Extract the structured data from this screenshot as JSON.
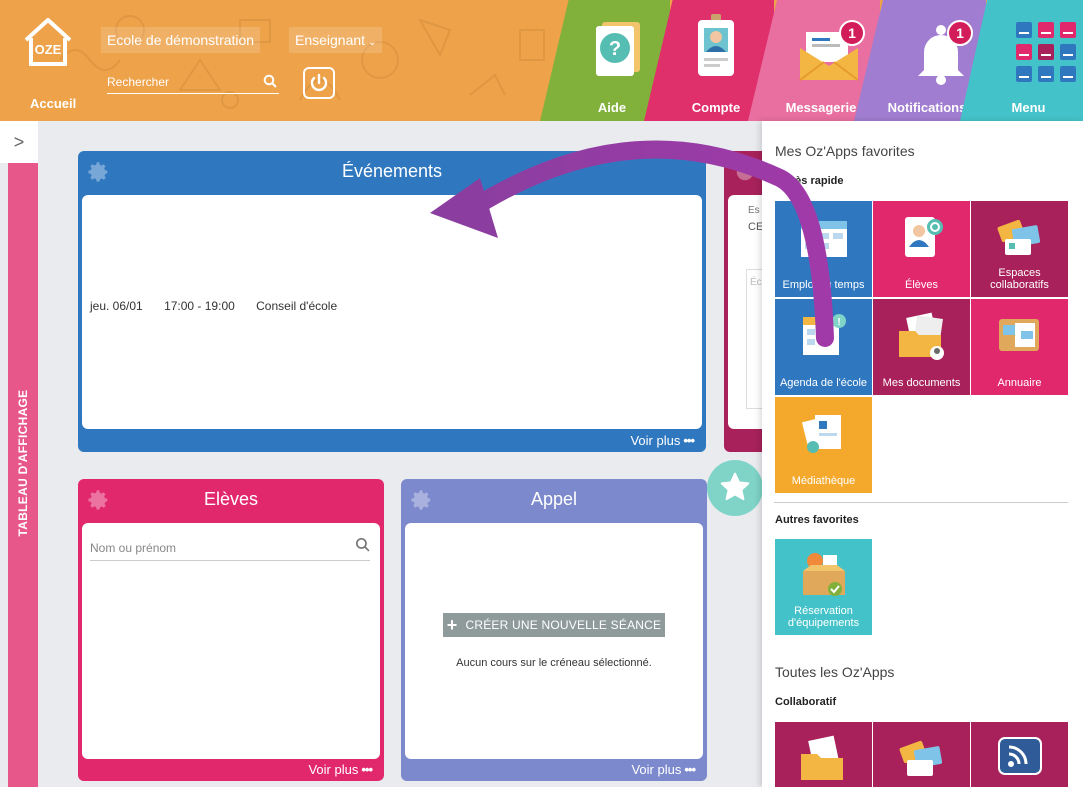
{
  "topbar": {
    "home_label": "Accueil",
    "school_label": "Ecole de démonstration",
    "role_label": "Enseignant",
    "search_placeholder": "Rechercher",
    "tiles": [
      {
        "label": "Aide",
        "color": "#82b13b"
      },
      {
        "label": "Compte",
        "color": "#e0306b"
      },
      {
        "label": "Messagerie",
        "color": "#e86f9f",
        "badge": "1"
      },
      {
        "label": "Notifications",
        "color": "#a07dd0",
        "badge": "1"
      },
      {
        "label": "Menu",
        "color": "#43c3c9"
      }
    ]
  },
  "rail": {
    "label": "TABLEAU D'AFFICHAGE",
    "toggle": ">"
  },
  "widgets": {
    "events": {
      "title": "Événements",
      "row": {
        "date": "jeu. 06/01",
        "time": "17:00 - 19:00",
        "name": "Conseil d'école"
      },
      "more": "Voir plus"
    },
    "right_fragment": {
      "line1": "Es",
      "line2": "CE",
      "line3": "Éc"
    },
    "eleves": {
      "title": "Elèves",
      "search_placeholder": "Nom ou prénom",
      "more": "Voir plus"
    },
    "appel": {
      "title": "Appel",
      "new_session": "CRÉER UNE NOUVELLE SÉANCE",
      "empty": "Aucun cours sur le créneau sélectionné.",
      "more": "Voir plus"
    }
  },
  "panel": {
    "title": "Mes Oz'Apps favorites",
    "quick_access": "Accès rapide",
    "quick_apps": [
      {
        "label": "Emploi du temps",
        "color": "#2f78c0",
        "icon": "calendar-icon"
      },
      {
        "label": "Élèves",
        "color": "#e2286d",
        "icon": "student-icon"
      },
      {
        "label": "Espaces collaboratifs",
        "color": "#a8215a",
        "icon": "collab-cards-icon"
      },
      {
        "label": "Agenda de l'école",
        "color": "#2f78c0",
        "icon": "agenda-icon"
      },
      {
        "label": "Mes documents",
        "color": "#a8215a",
        "icon": "folder-icon"
      },
      {
        "label": "Annuaire",
        "color": "#e2286d",
        "icon": "directory-icon"
      },
      {
        "label": "Médiathèque",
        "color": "#f4a92c",
        "icon": "media-icon"
      }
    ],
    "other_favorites": "Autres favorites",
    "other_apps": [
      {
        "label": "Réservation d'équipements",
        "color": "#43c3c9",
        "icon": "equipment-box-icon"
      }
    ],
    "all_apps": "Toutes les Oz'Apps",
    "category": "Collaboratif",
    "category_apps": [
      {
        "color": "#a8215a",
        "icon": "folder-icon"
      },
      {
        "color": "#a8215a",
        "icon": "collab-cards-icon"
      },
      {
        "color": "#a8215a",
        "icon": "rss-icon"
      }
    ]
  }
}
